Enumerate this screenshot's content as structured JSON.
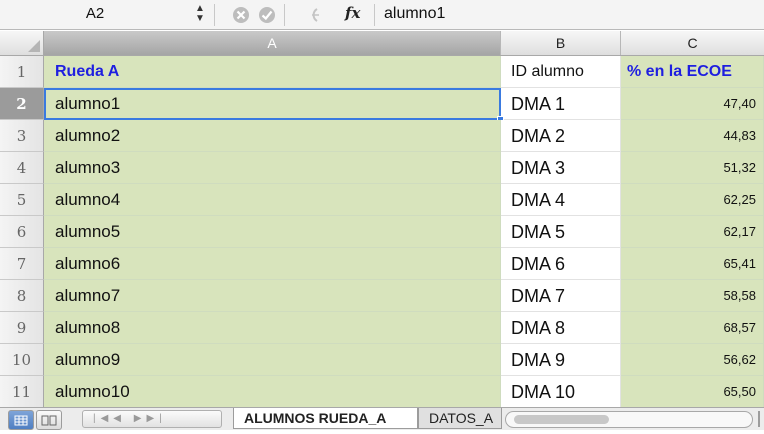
{
  "formula_bar": {
    "name_box": "A2",
    "formula": "alumno1"
  },
  "columns": [
    {
      "letter": "A",
      "selected": true
    },
    {
      "letter": "B",
      "selected": false
    },
    {
      "letter": "C",
      "selected": false
    }
  ],
  "header_row": {
    "row_number": "1",
    "a": "Rueda A",
    "b": "ID alumno",
    "c": "% en la ECOE"
  },
  "rows": [
    {
      "n": "2",
      "a": "alumno1",
      "b": "DMA 1",
      "c": "47,40"
    },
    {
      "n": "3",
      "a": "alumno2",
      "b": "DMA 2",
      "c": "44,83"
    },
    {
      "n": "4",
      "a": "alumno3",
      "b": "DMA 3",
      "c": "51,32"
    },
    {
      "n": "5",
      "a": "alumno4",
      "b": "DMA 4",
      "c": "62,25"
    },
    {
      "n": "6",
      "a": "alumno5",
      "b": "DMA 5",
      "c": "62,17"
    },
    {
      "n": "7",
      "a": "alumno6",
      "b": "DMA 6",
      "c": "65,41"
    },
    {
      "n": "8",
      "a": "alumno7",
      "b": "DMA 7",
      "c": "58,58"
    },
    {
      "n": "9",
      "a": "alumno8",
      "b": "DMA 8",
      "c": "68,57"
    },
    {
      "n": "10",
      "a": "alumno9",
      "b": "DMA 9",
      "c": "56,62"
    },
    {
      "n": "11",
      "a": "alumno10",
      "b": "DMA 10",
      "c": "65,50"
    }
  ],
  "sheet_tabs": [
    {
      "label": "ALUMNOS RUEDA_A",
      "active": true
    },
    {
      "label": "DATOS_A",
      "active": false
    }
  ],
  "colors": {
    "data_fill": "#d8e4bc",
    "header_text": "#1f1fe0",
    "selection": "#3a7ae0"
  }
}
